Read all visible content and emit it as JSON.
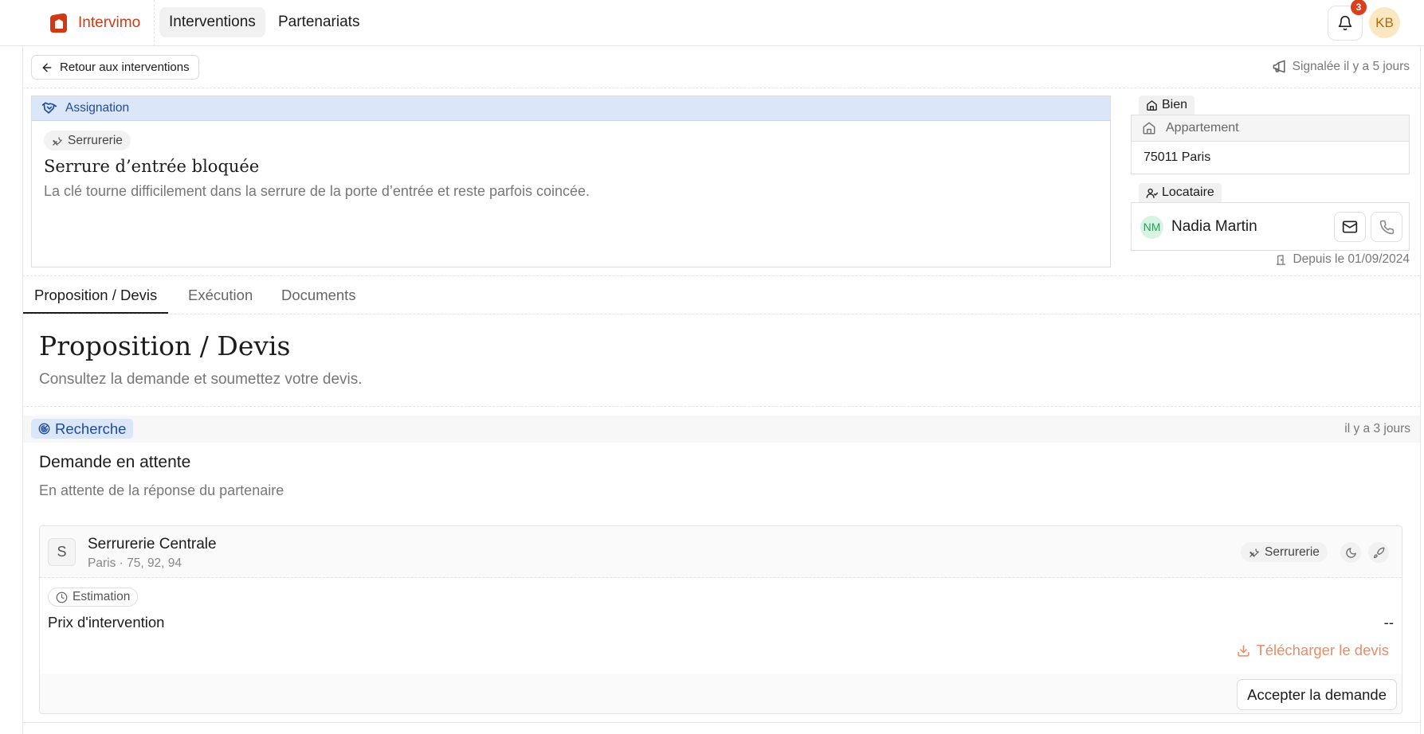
{
  "app": {
    "name": "Intervimo"
  },
  "nav": {
    "items": [
      {
        "label": "Interventions",
        "active": true
      },
      {
        "label": "Partenariats",
        "active": false
      }
    ]
  },
  "header": {
    "notification_count": "3",
    "user_initials": "KB"
  },
  "toolbar": {
    "back_label": "Retour aux interventions",
    "reported_label": "Signalée il y a 5 jours"
  },
  "request": {
    "section_label": "Assignation",
    "category": "Serrurerie",
    "title": "Serrure d’entrée bloquée",
    "description": "La clé tourne difficilement dans la serrure de la porte d’entrée et reste parfois coincée."
  },
  "property": {
    "label": "Bien",
    "type": "Appartement",
    "city": "75011 Paris"
  },
  "tenant": {
    "label": "Locataire",
    "initials": "NM",
    "name": "Nadia Martin",
    "since": "Depuis le 01/09/2024"
  },
  "tabs": [
    {
      "label": "Proposition / Devis",
      "active": true
    },
    {
      "label": "Exécution",
      "active": false
    },
    {
      "label": "Documents",
      "active": false
    }
  ],
  "section": {
    "title": "Proposition / Devis",
    "subtitle": "Consultez la demande et soumettez votre devis."
  },
  "status": {
    "label": "Recherche",
    "time": "il y a 3 jours",
    "title": "Demande en attente",
    "subtitle": "En attente de la réponse du partenaire"
  },
  "partner": {
    "initial": "S",
    "name": "Serrurerie Centrale",
    "zone": "Paris · 75, 92, 94",
    "category": "Serrurerie",
    "estimation_label": "Estimation",
    "price_label": "Prix d'intervention",
    "price_value": "--",
    "download_label": "Télécharger le devis",
    "accept_label": "Accepter la demande"
  },
  "colors": {
    "brand": "#cf3a14",
    "accent_blue": "#1e4a9e",
    "accent_blue_bg": "#dbe7f9",
    "download": "#e98c6a",
    "badge": "#d9401b"
  },
  "icons": [
    "logo-icon",
    "bell-icon",
    "arrow-left-icon",
    "megaphone-icon",
    "handshake-icon",
    "wrench-icon",
    "home-icon",
    "user-icon",
    "mail-icon",
    "phone-icon",
    "door-icon",
    "radar-icon",
    "moon-icon",
    "rocket-icon",
    "clock-icon",
    "download-icon"
  ]
}
